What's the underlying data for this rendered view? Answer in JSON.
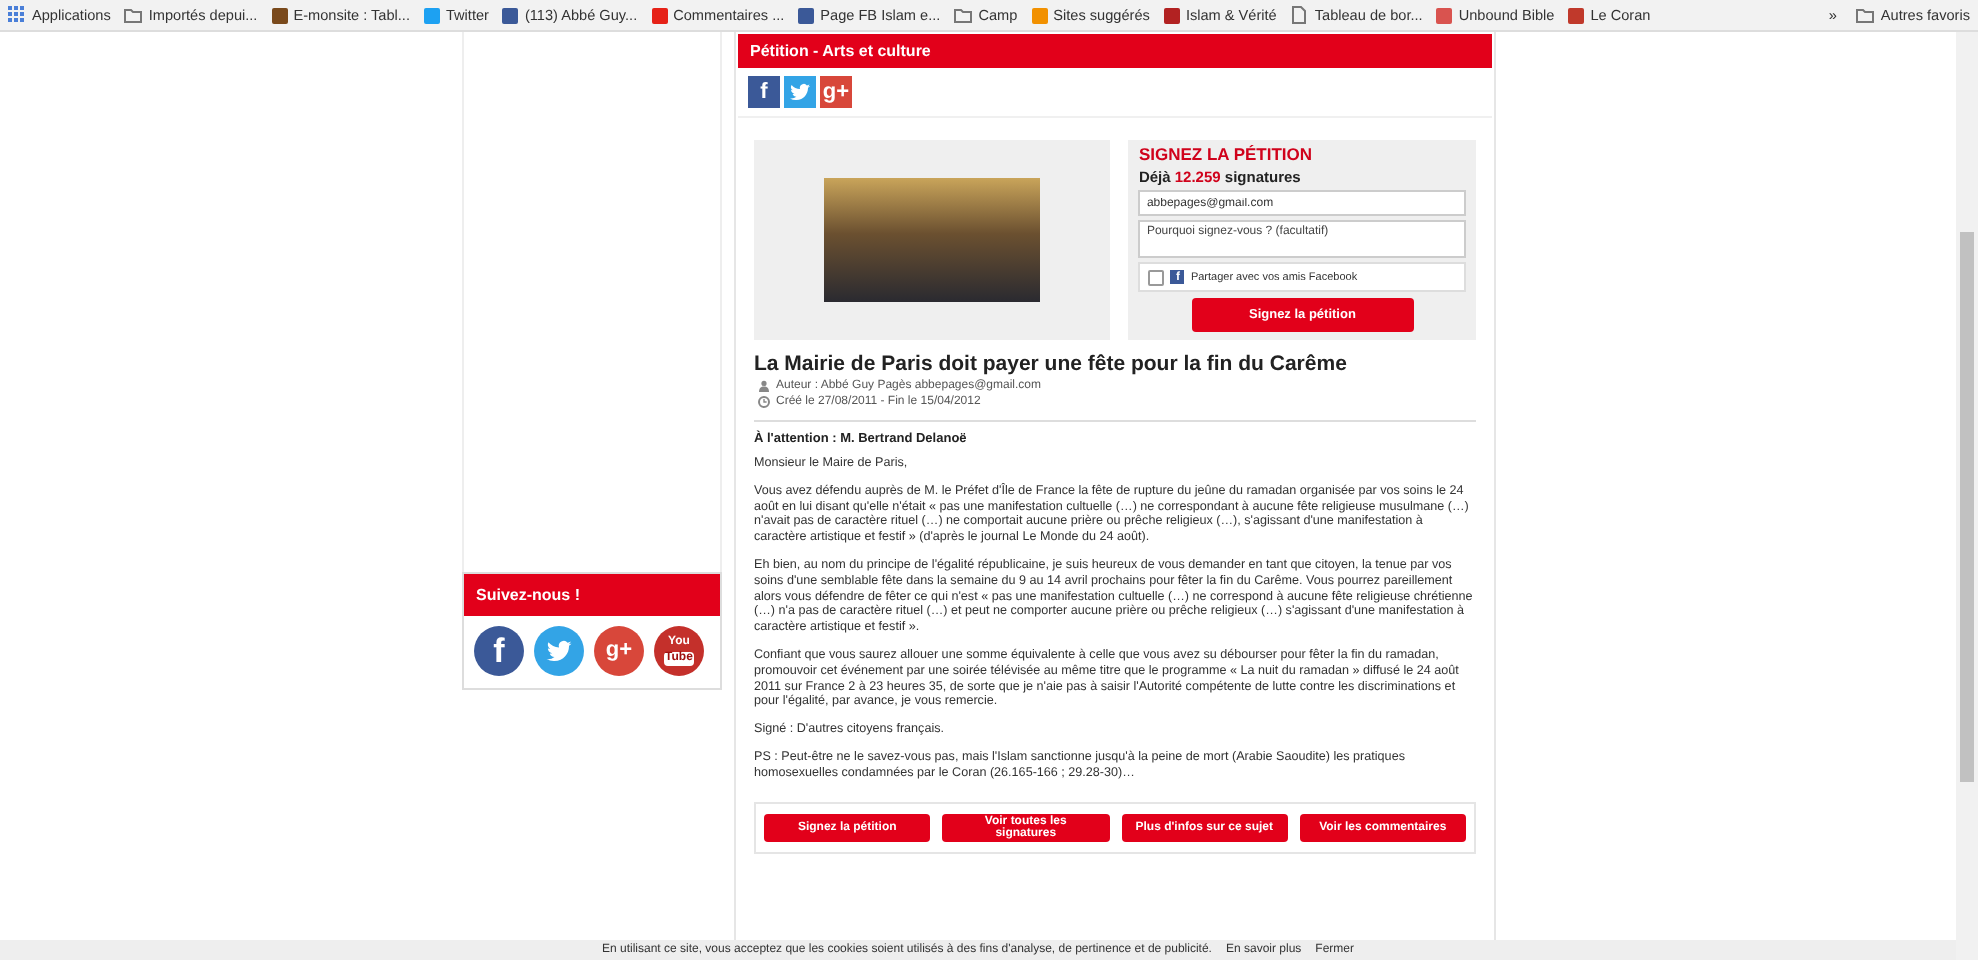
{
  "bookmarks": [
    {
      "kind": "apps",
      "label": "Applications"
    },
    {
      "kind": "folder",
      "label": "Importés depui..."
    },
    {
      "kind": "site",
      "label": "E-monsite : Tabl...",
      "color": "#7a4a1c"
    },
    {
      "kind": "site",
      "label": "Twitter",
      "color": "#1da1f2"
    },
    {
      "kind": "site",
      "label": "(113) Abbé Guy...",
      "color": "#3b5998"
    },
    {
      "kind": "site",
      "label": "Commentaires ...",
      "color": "#e62117"
    },
    {
      "kind": "site",
      "label": "Page FB Islam e...",
      "color": "#3b5998"
    },
    {
      "kind": "folder",
      "label": "Camp"
    },
    {
      "kind": "site",
      "label": "Sites suggérés",
      "color": "#f29100"
    },
    {
      "kind": "site",
      "label": "Islam & Vérité",
      "color": "#b22222"
    },
    {
      "kind": "page",
      "label": "Tableau de bor..."
    },
    {
      "kind": "site",
      "label": "Unbound Bible",
      "color": "#d9534f"
    },
    {
      "kind": "site",
      "label": "Le Coran",
      "color": "#c0392b"
    }
  ],
  "bookmarks_overflow": "»",
  "other_bookmarks": "Autres favoris",
  "sidebar": {
    "follow_title": "Suivez-nous !",
    "follow_icons": [
      {
        "kind": "facebook",
        "glyph": "f"
      },
      {
        "kind": "twitter"
      },
      {
        "kind": "google",
        "glyph": "g+"
      },
      {
        "kind": "youtube",
        "glyph": "You",
        "glyph2": "Tube"
      }
    ]
  },
  "petition": {
    "category": "Pétition - Arts et culture",
    "share": [
      {
        "kind": "facebook",
        "glyph": "f"
      },
      {
        "kind": "twitter"
      },
      {
        "kind": "google",
        "glyph": "g+"
      }
    ],
    "sign_title": "SIGNEZ LA PÉTITION",
    "count_prefix": "Déjà",
    "count": "12.259",
    "count_suffix": "signatures",
    "email_value": "abbepages@gmail.com",
    "reason_placeholder": "Pourquoi signez-vous ? (facultatif)",
    "share_facebook": {
      "glyph": "f",
      "label": "Partager avec vos amis Facebook",
      "checked": false
    },
    "sign_button": "Signez la pétition",
    "title": "La Mairie de Paris doit payer une fête pour la fin du Carême",
    "author": "Auteur : Abbé Guy Pagès abbepages@gmail.com",
    "dates": "Créé le 27/08/2011 - Fin le 15/04/2012",
    "recipient": "À l'attention : M. Bertrand Delanoë",
    "paragraphs": [
      "Monsieur le Maire de Paris,",
      "Vous avez défendu auprès de M. le Préfet d'Île de France la fête de rupture du jeûne du ramadan organisée par vos soins le 24 août en lui disant qu'elle n'était « pas une manifestation cultuelle (…) ne correspondant à aucune fête religieuse musulmane (…) n'avait pas de caractère rituel (…) ne comportait aucune prière ou prêche religieux (…), s'agissant d'une manifestation à caractère artistique et festif » (d'après le journal Le Monde du 24 août).",
      "Eh bien, au nom du principe de l'égalité républicaine, je suis heureux de vous demander en tant que citoyen, la tenue par vos soins d'une semblable fête dans la semaine du 9 au 14 avril prochains pour fêter la fin du Carême. Vous pourrez pareillement alors vous défendre de fêter ce qui n'est « pas une manifestation cultuelle (…) ne correspond à aucune fête religieuse chrétienne (…) n'a pas de caractère rituel (…) et peut ne comporter aucune prière ou prêche religieux (…) s'agissant d'une manifestation à caractère artistique et festif ».",
      "Confiant que vous saurez allouer une somme équivalente à celle que vous avez su débourser pour fêter la fin du ramadan, promouvoir cet événement par une soirée télévisée au même titre que le programme « La nuit du ramadan » diffusé le 24 août 2011 sur France 2 à 23 heures 35, de sorte que je n'aie pas à saisir l'Autorité compétente de lutte contre les discriminations et pour l'égalité, par avance, je vous remercie.",
      "Signé : D'autres citoyens français.",
      "PS : Peut-être ne le savez-vous pas, mais l'Islam sanctionne jusqu'à la peine de mort (Arabie Saoudite) les pratiques homosexuelles condamnées par le Coran (26.165-166 ; 29.28-30)…"
    ],
    "actions": [
      "Signez la pétition",
      "Voir toutes les signatures",
      "Plus d'infos sur ce sujet",
      "Voir les commentaires"
    ]
  },
  "cookie_bar": {
    "text": "En utilisant ce site, vous acceptez que les cookies soient utilisés à des fins d'analyse, de pertinence et de publicité.",
    "link": "En savoir plus",
    "close": "Fermer"
  }
}
